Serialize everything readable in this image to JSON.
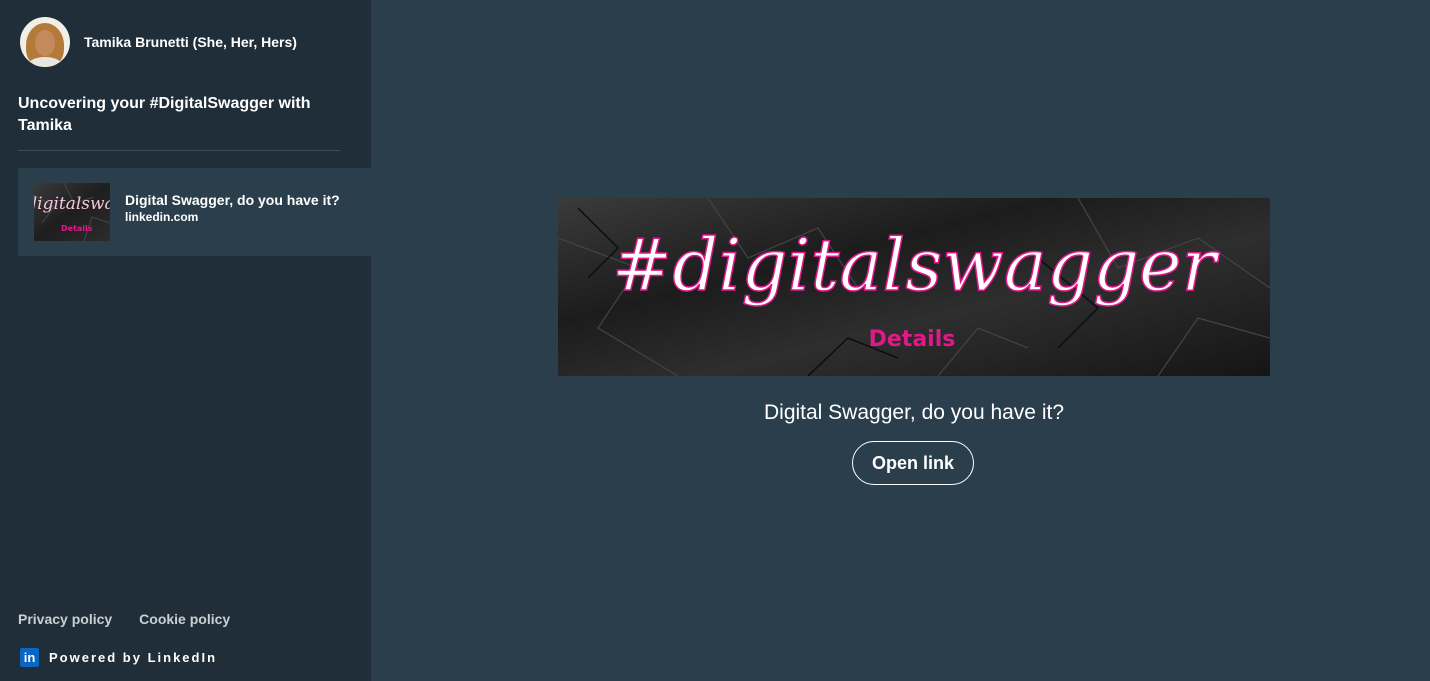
{
  "sidebar": {
    "author": {
      "name": "Tamika Brunetti (She, Her, Hers)",
      "avatar_icon": "person-photo"
    },
    "newsletter_title": "Uncovering your #DigitalSwagger with Tamika",
    "articles": [
      {
        "title": "Digital Swagger, do you have it?",
        "domain": "linkedin.com",
        "thumb_text": "#digitalswagger",
        "thumb_brand": "Details"
      }
    ],
    "footer": {
      "privacy_label": "Privacy policy",
      "cookie_label": "Cookie policy",
      "powered_label": "Powered by LinkedIn",
      "logo_text": "in"
    }
  },
  "main": {
    "hero_text": "#digitalswagger",
    "hero_brand": "Details",
    "title": "Digital Swagger, do you have it?",
    "open_link_label": "Open link"
  },
  "colors": {
    "sidebar_bg": "#1f2e39",
    "main_bg": "#2a3e4c",
    "accent_pink": "#e0198a",
    "linkedin_blue": "#0a66c2"
  }
}
